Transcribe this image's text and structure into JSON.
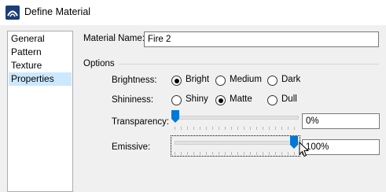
{
  "window": {
    "title": "Define Material"
  },
  "nav": {
    "items": [
      "General",
      "Pattern",
      "Texture",
      "Properties"
    ],
    "selected": "Properties"
  },
  "material": {
    "name_label": "Material Name:",
    "name_value": "Fire 2"
  },
  "options": {
    "label": "Options",
    "brightness": {
      "label": "Brightness:",
      "choices": [
        "Bright",
        "Medium",
        "Dark"
      ],
      "selected": "Bright"
    },
    "shininess": {
      "label": "Shininess:",
      "choices": [
        "Shiny",
        "Matte",
        "Dull"
      ],
      "selected": "Matte"
    },
    "transparency": {
      "label": "Transparency:",
      "value": "0%",
      "level": 0
    },
    "emissive": {
      "label": "Emissive:",
      "value": "100%",
      "level": 1
    }
  },
  "colors": {
    "accent": "#0078d7",
    "selection": "#cce8ff"
  }
}
